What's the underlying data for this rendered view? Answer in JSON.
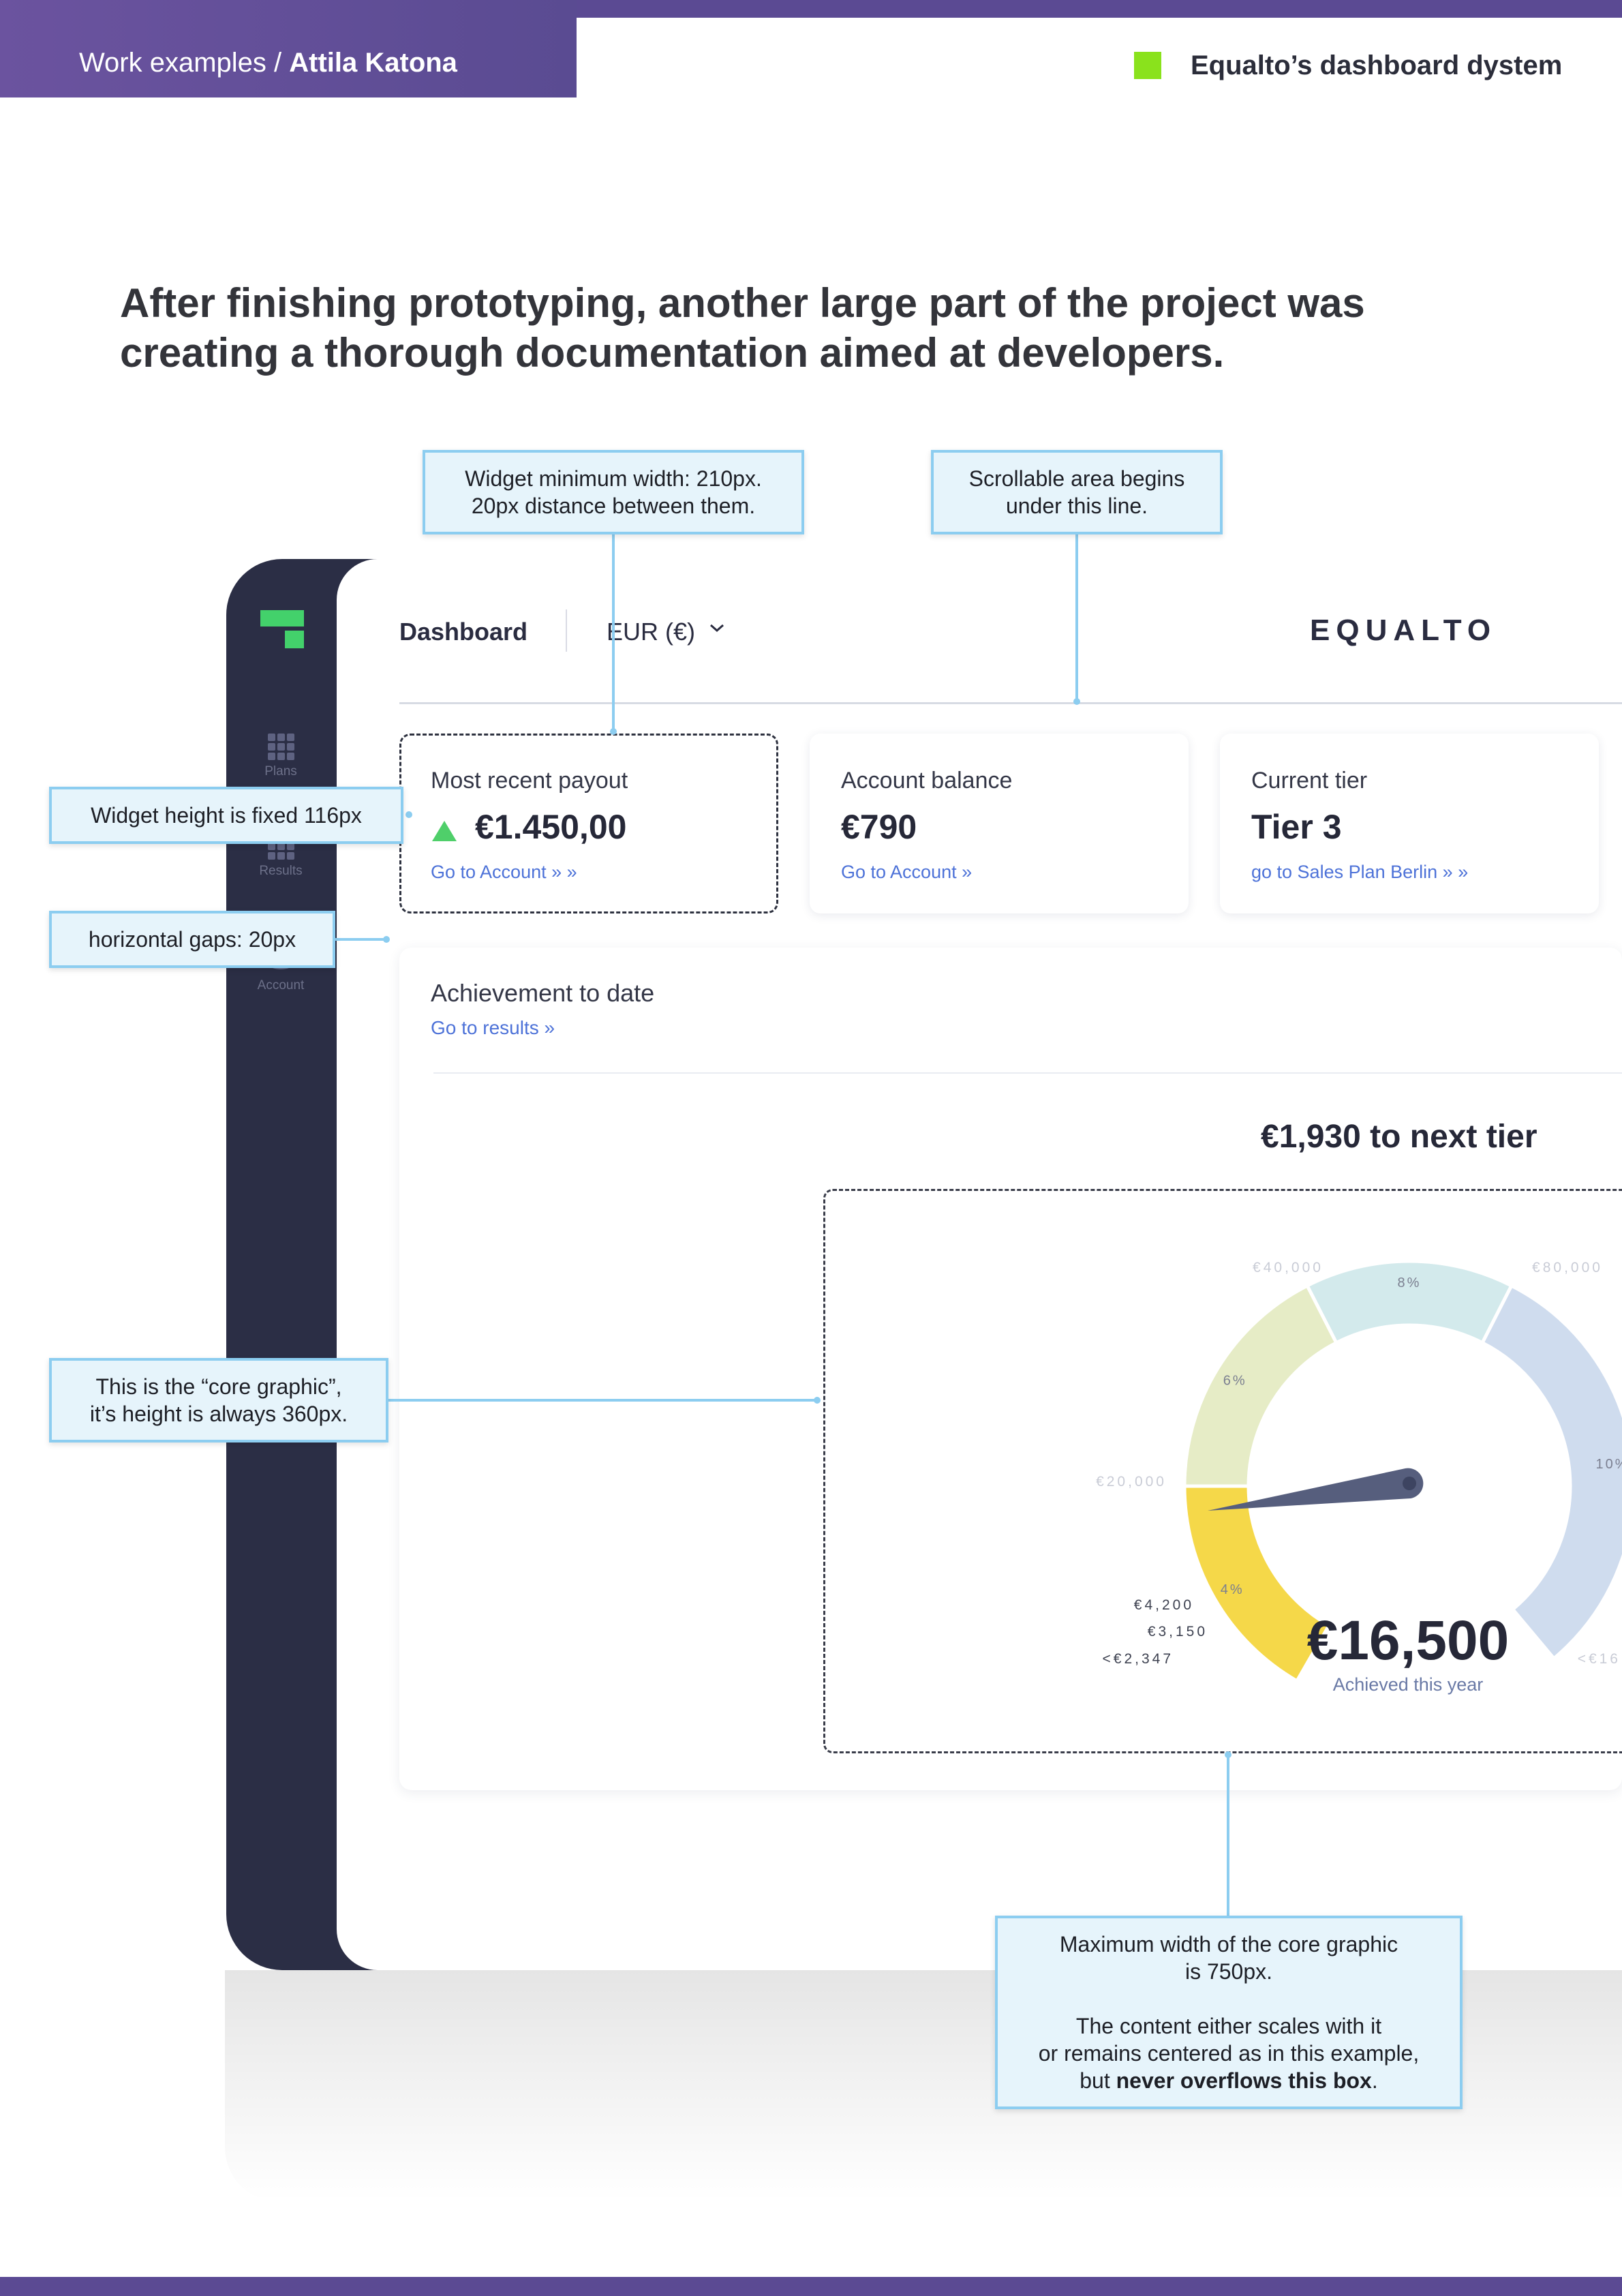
{
  "header": {
    "breadcrumb_prefix": "Work examples / ",
    "author": "Attila Katona",
    "project_title": "Equalto’s dashboard dystem"
  },
  "headline": {
    "line1": "After finishing prototyping, another large part of the project was",
    "line2": "creating a thorough documentation aimed at developers."
  },
  "colors": {
    "brand_purple": "#5b4a93",
    "brand_green": "#8ae21c",
    "sidebar": "#2b2e45",
    "link_blue": "#4d72d8",
    "annotation_fill": "#e6f4fb",
    "annotation_border": "#8ccdf0"
  },
  "sidebar": {
    "logo_icon": "equalto-logo-icon",
    "items": [
      {
        "label": "Plans",
        "icon": "grid-icon"
      },
      {
        "label": "Results",
        "icon": "table-icon"
      },
      {
        "label": "Account",
        "icon": "stack-icon"
      }
    ]
  },
  "topbar": {
    "title": "Dashboard",
    "currency": "EUR (€)",
    "wordmark": "EQUALTO"
  },
  "widgets": [
    {
      "label": "Most recent payout",
      "value": "€1.450,00",
      "link": "Go to Account »",
      "trend_icon": "up-triangle-icon"
    },
    {
      "label": "Account balance",
      "value": "€790",
      "link": "Go to Account"
    },
    {
      "label": "Current tier",
      "value": "Tier 3",
      "link": "go to Sales Plan Berlin »"
    }
  ],
  "achievement": {
    "title": "Achievement to date",
    "link": "Go to results",
    "next_tier": "€1,930 to next tier",
    "achieved_value": "€16,500",
    "achieved_caption": "Achieved this year"
  },
  "chart_data": {
    "type": "gauge",
    "value": 16500,
    "segments": [
      {
        "label": "",
        "threshold": "<€2,347",
        "color": "#e8823a"
      },
      {
        "label": "",
        "threshold": "€3,150",
        "color": "#eea83f"
      },
      {
        "label": "",
        "threshold": "€4,200",
        "color": "#f3c53b"
      },
      {
        "label": "4%",
        "threshold": "€20,000",
        "color": "#f5d849"
      },
      {
        "label": "6%",
        "threshold": "€40,000",
        "color": "#e6ecc6"
      },
      {
        "label": "8%",
        "threshold": "€80,000",
        "color": "#d3eaec"
      },
      {
        "label": "10%",
        "threshold": "<€16",
        "color": "#cfdcee"
      }
    ],
    "needle_color": "#565e7d"
  },
  "annotations": {
    "widget_width": [
      "Widget minimum width: 210px.",
      "20px distance between them."
    ],
    "scroll_area": [
      "Scrollable area begins",
      "under this line."
    ],
    "widget_height": "Widget height is fixed 116px",
    "gaps": "horizontal gaps: 20px",
    "core_graphic": [
      "This is the “core graphic”,",
      "it’s height is always 360px."
    ],
    "max_width": {
      "line1": "Maximum width of the core graphic",
      "line2": "is 750px.",
      "line3": "The content either scales with it",
      "line4": "or remains centered as in this example,",
      "line5_prefix": "but ",
      "line5_bold": "never overflows this box",
      "line5_suffix": "."
    }
  }
}
